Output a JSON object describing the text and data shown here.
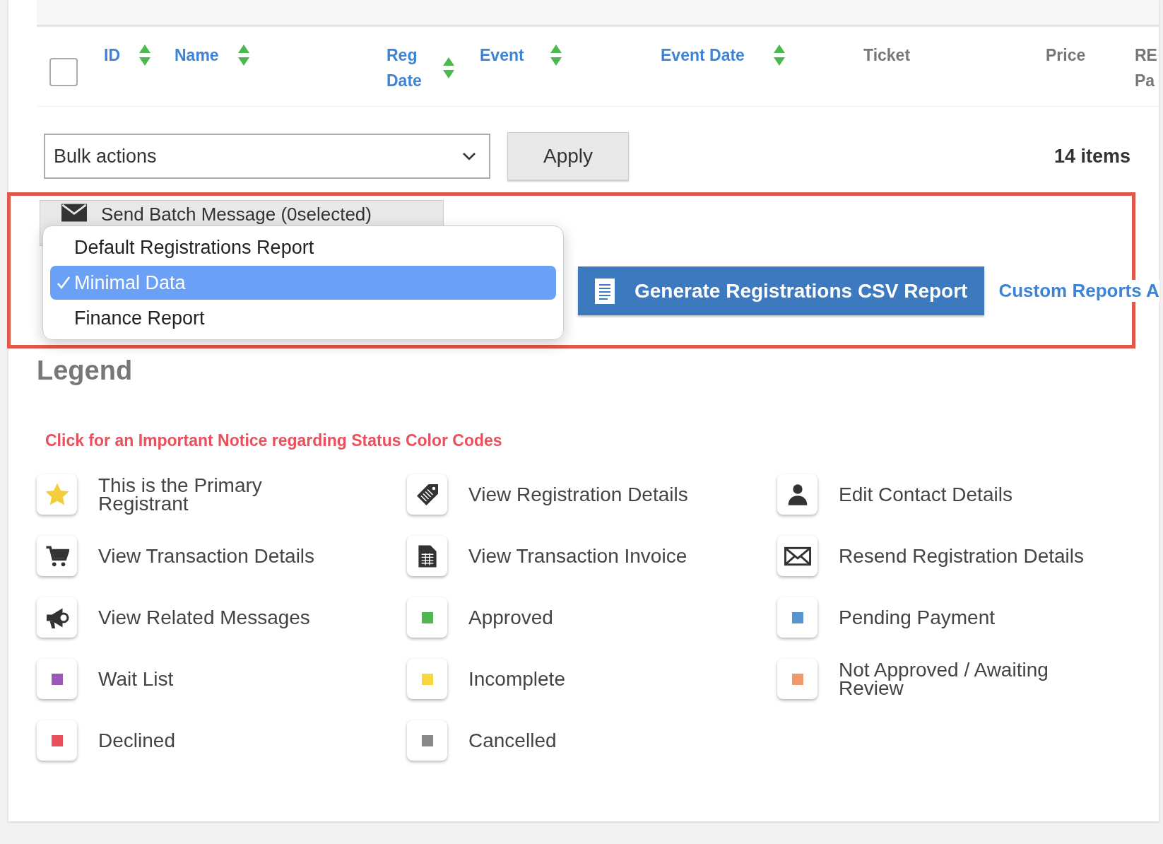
{
  "table": {
    "select_all": {
      "checked": false
    },
    "columns": [
      {
        "label": "ID",
        "sortable": true
      },
      {
        "label": "Name",
        "sortable": true
      },
      {
        "label": "Reg Date",
        "sortable": true
      },
      {
        "label": "Event",
        "sortable": true
      },
      {
        "label": "Event Date",
        "sortable": true
      },
      {
        "label": "Ticket",
        "sortable": false
      },
      {
        "label": "Price",
        "sortable": false
      },
      {
        "label": "RE Pa",
        "sortable": false
      }
    ]
  },
  "bulk_actions": {
    "value": "Bulk actions",
    "apply": "Apply",
    "count": "14 items"
  },
  "reports": {
    "batch_button": "Send Batch Message (0selected)",
    "report_menu": [
      {
        "label": "Default Registrations Report",
        "selected": false
      },
      {
        "label": "Minimal Data",
        "selected": true
      },
      {
        "label": "Finance Report",
        "selected": false
      }
    ],
    "generate_button": "Generate Registrations CSV Report",
    "custom_link": "Custom Reports A"
  },
  "legend": {
    "title": "Legend",
    "notice": "Click for an Important Notice regarding Status Color Codes",
    "items": [
      {
        "kind": "icon",
        "label": "This is the Primary Registrant"
      },
      {
        "kind": "icon",
        "label": "View Registration Details"
      },
      {
        "kind": "icon",
        "label": "Edit Contact Details"
      },
      {
        "kind": "icon",
        "label": "View Transaction Details"
      },
      {
        "kind": "icon",
        "label": "View Transaction Invoice"
      },
      {
        "kind": "icon",
        "label": "Resend Registration Details"
      },
      {
        "kind": "icon",
        "label": "View Related Messages"
      },
      {
        "kind": "status",
        "label": "Approved",
        "color": "#4cb94f"
      },
      {
        "kind": "status",
        "label": "Pending Payment",
        "color": "#5495d2"
      },
      {
        "kind": "status",
        "label": "Wait List",
        "color": "#9b59b6"
      },
      {
        "kind": "status",
        "label": "Incomplete",
        "color": "#f5d73f"
      },
      {
        "kind": "status",
        "label": "Not Approved / Awaiting Review",
        "color": "#f0996b"
      },
      {
        "kind": "status",
        "label": "Declined",
        "color": "#e8505b"
      },
      {
        "kind": "status",
        "label": "Cancelled",
        "color": "#888888"
      }
    ]
  }
}
